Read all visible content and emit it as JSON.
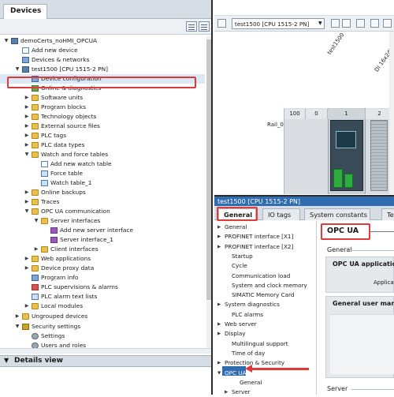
{
  "left": {
    "tab": "Devices",
    "tree": [
      {
        "label": "demoCerts_noHMI_OPCUA",
        "toggle": "▼",
        "icon": "dev"
      },
      {
        "label": "Add new device",
        "toggle": "",
        "icon": "add"
      },
      {
        "label": "Devices & networks",
        "toggle": "",
        "icon": "blue"
      },
      {
        "label": "test1500 [CPU 1515-2 PN]",
        "toggle": "▼",
        "icon": "dev"
      },
      {
        "label": "Device configuration",
        "toggle": "",
        "icon": "blue"
      },
      {
        "label": "Online & diagnostics",
        "toggle": "",
        "icon": "green"
      },
      {
        "label": "Software units",
        "toggle": "▶",
        "icon": "folder"
      },
      {
        "label": "Program blocks",
        "toggle": "▶",
        "icon": "folder"
      },
      {
        "label": "Technology objects",
        "toggle": "▶",
        "icon": "folder"
      },
      {
        "label": "External source files",
        "toggle": "▶",
        "icon": "folder"
      },
      {
        "label": "PLC tags",
        "toggle": "▶",
        "icon": "folder"
      },
      {
        "label": "PLC data types",
        "toggle": "▶",
        "icon": "folder"
      },
      {
        "label": "Watch and force tables",
        "toggle": "▼",
        "icon": "folder"
      },
      {
        "label": "Add new watch table",
        "toggle": "",
        "icon": "add"
      },
      {
        "label": "Force table",
        "toggle": "",
        "icon": "table"
      },
      {
        "label": "Watch table_1",
        "toggle": "",
        "icon": "table"
      },
      {
        "label": "Online backups",
        "toggle": "▶",
        "icon": "folder"
      },
      {
        "label": "Traces",
        "toggle": "▶",
        "icon": "folder"
      },
      {
        "label": "OPC UA communication",
        "toggle": "▼",
        "icon": "folder"
      },
      {
        "label": "Server interfaces",
        "toggle": "▼",
        "icon": "folder"
      },
      {
        "label": "Add new server interface",
        "toggle": "",
        "icon": "purple"
      },
      {
        "label": "Server interface_1",
        "toggle": "",
        "icon": "purple"
      },
      {
        "label": "Client interfaces",
        "toggle": "▶",
        "icon": "folder"
      },
      {
        "label": "Web applications",
        "toggle": "▶",
        "icon": "folder"
      },
      {
        "label": "Device proxy data",
        "toggle": "▶",
        "icon": "folder"
      },
      {
        "label": "Program info",
        "toggle": "",
        "icon": "blue"
      },
      {
        "label": "PLC supervisions & alarms",
        "toggle": "",
        "icon": "red"
      },
      {
        "label": "PLC alarm text lists",
        "toggle": "",
        "icon": "table"
      },
      {
        "label": "Local modules",
        "toggle": "▶",
        "icon": "folder"
      },
      {
        "label": "Ungrouped devices",
        "toggle": "▶",
        "icon": "folder"
      },
      {
        "label": "Security settings",
        "toggle": "▼",
        "icon": "lock"
      },
      {
        "label": "Settings",
        "toggle": "",
        "icon": "gear"
      },
      {
        "label": "Users and roles",
        "toggle": "",
        "icon": "gear"
      }
    ],
    "details_title": "Details view"
  },
  "device_view": {
    "cpu_select": "test1500 [CPU 1515-2 PN]",
    "label_cpu": "test1500",
    "label_di": "DI 16x24VDC",
    "rail": "Rail_0",
    "slots": [
      "100",
      "0",
      "1",
      "2"
    ]
  },
  "properties": {
    "title": "test1500 [CPU 1515-2 PN]",
    "tabs": [
      "General",
      "IO tags",
      "System constants",
      "Te"
    ],
    "nav": [
      {
        "label": "General",
        "toggle": "▶",
        "indent": 0
      },
      {
        "label": "PROFINET interface [X1]",
        "toggle": "▶",
        "indent": 0
      },
      {
        "label": "PROFINET interface [X2]",
        "toggle": "▶",
        "indent": 0
      },
      {
        "label": "Startup",
        "toggle": "",
        "indent": 1
      },
      {
        "label": "Cycle",
        "toggle": "",
        "indent": 1
      },
      {
        "label": "Communication load",
        "toggle": "",
        "indent": 1
      },
      {
        "label": "System and clock memory",
        "toggle": "",
        "indent": 1
      },
      {
        "label": "SIMATIC Memory Card",
        "toggle": "",
        "indent": 1
      },
      {
        "label": "System diagnostics",
        "toggle": "▶",
        "indent": 0
      },
      {
        "label": "PLC alarms",
        "toggle": "",
        "indent": 1
      },
      {
        "label": "Web server",
        "toggle": "▶",
        "indent": 0
      },
      {
        "label": "Display",
        "toggle": "▶",
        "indent": 0
      },
      {
        "label": "Multilingual support",
        "toggle": "",
        "indent": 1
      },
      {
        "label": "Time of day",
        "toggle": "",
        "indent": 1
      },
      {
        "label": "Protection & Security",
        "toggle": "▶",
        "indent": 0
      },
      {
        "label": "OPC UA",
        "toggle": "▼",
        "indent": 0
      },
      {
        "label": "General",
        "toggle": "",
        "indent": 2
      },
      {
        "label": "Server",
        "toggle": "▶",
        "indent": 1
      }
    ],
    "content": {
      "heading": "OPC UA",
      "general": "General",
      "panel1_title": "OPC UA applicatio",
      "panel1_sub": "Applica",
      "panel2_title": "General user mana",
      "server": "Server"
    }
  }
}
